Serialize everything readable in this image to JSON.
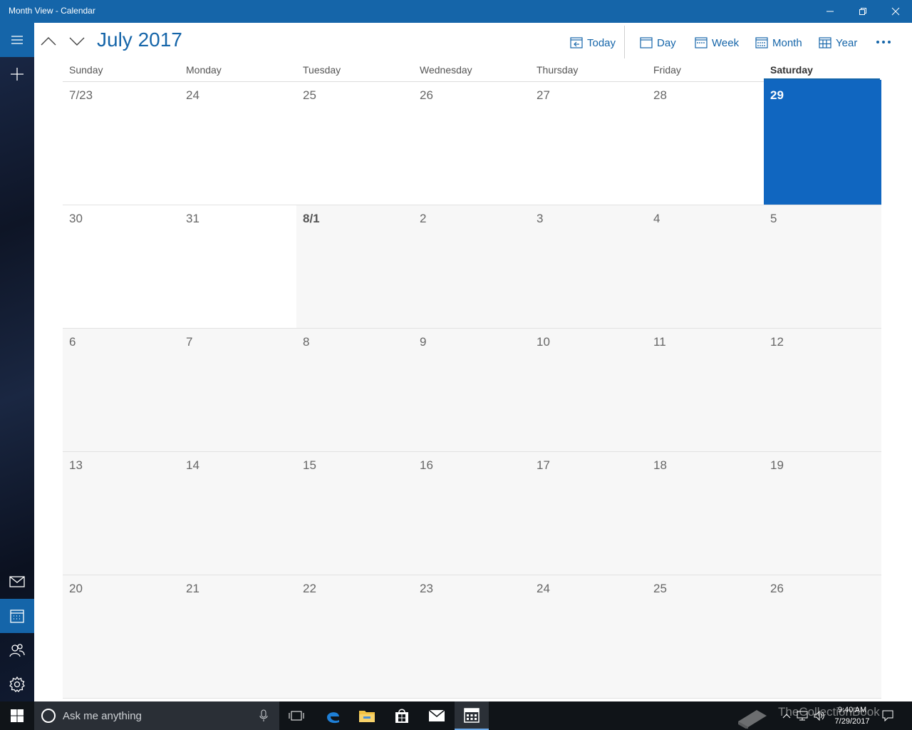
{
  "window": {
    "title": "Month View - Calendar"
  },
  "header": {
    "month_title": "July 2017",
    "views": {
      "today": "Today",
      "day": "Day",
      "week": "Week",
      "month": "Month",
      "year": "Year"
    }
  },
  "days_of_week": [
    "Sunday",
    "Monday",
    "Tuesday",
    "Wednesday",
    "Thursday",
    "Friday",
    "Saturday"
  ],
  "today_index": 6,
  "weeks": [
    [
      "7/23",
      "24",
      "25",
      "26",
      "27",
      "28",
      "29"
    ],
    [
      "30",
      "31",
      "8/1",
      "2",
      "3",
      "4",
      "5"
    ],
    [
      "6",
      "7",
      "8",
      "9",
      "10",
      "11",
      "12"
    ],
    [
      "13",
      "14",
      "15",
      "16",
      "17",
      "18",
      "19"
    ],
    [
      "20",
      "21",
      "22",
      "23",
      "24",
      "25",
      "26"
    ]
  ],
  "taskbar": {
    "search_placeholder": "Ask me anything",
    "time": "9:40 AM",
    "date": "7/29/2017",
    "watermark": "TheCollectionBook"
  },
  "colors": {
    "accent": "#1565a9",
    "today_cell": "#1066c0",
    "taskbar": "#101418"
  }
}
